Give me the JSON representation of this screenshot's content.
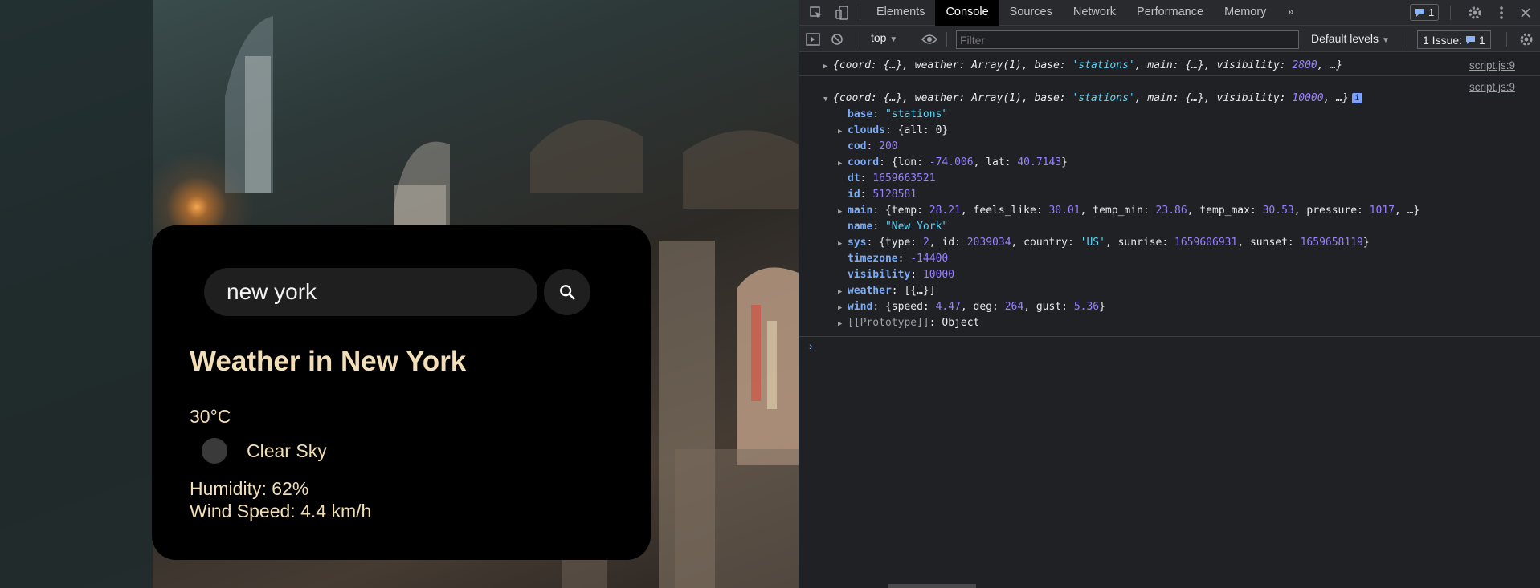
{
  "app": {
    "search": {
      "value": "new york",
      "button_icon": "search-icon"
    },
    "title": "Weather in New York",
    "temperature": "30°C",
    "icon": "weather-icon",
    "description": "Clear Sky",
    "humidity": "Humidity: 62%",
    "wind": "Wind Speed: 4.4 km/h",
    "colors": {
      "card": "#000000",
      "text": "#f3dfb7"
    }
  },
  "devtools": {
    "tabs": [
      {
        "label": "Elements"
      },
      {
        "label": "Console",
        "active": true
      },
      {
        "label": "Sources"
      },
      {
        "label": "Network"
      },
      {
        "label": "Performance"
      },
      {
        "label": "Memory"
      }
    ],
    "more_tabs": "»",
    "message_count": "1",
    "context": "top",
    "filter_placeholder": "Filter",
    "levels": "Default levels",
    "issues_label": "1 Issue:",
    "issues_count": "1",
    "console": {
      "entry1": {
        "summary": {
          "coord": "{…}",
          "weather": "Array(1)",
          "base": "'stations'",
          "main": "{…}",
          "visibility": "2800"
        },
        "source": "script.js:9"
      },
      "entry2": {
        "summary": {
          "coord": "{…}",
          "weather": "Array(1)",
          "base": "'stations'",
          "main": "{…}",
          "visibility": "10000"
        },
        "source": "script.js:9",
        "props": {
          "base": "\"stations\"",
          "clouds": "{all: 0}",
          "cod": "200",
          "coord_lon": "-74.006",
          "coord_lat": "40.7143",
          "dt": "1659663521",
          "id": "5128581",
          "main_temp": "28.21",
          "main_feels_like": "30.01",
          "main_temp_min": "23.86",
          "main_temp_max": "30.53",
          "main_pressure": "1017",
          "name": "\"New York\"",
          "sys_type": "2",
          "sys_id": "2039034",
          "sys_country": "'US'",
          "sys_sunrise": "1659606931",
          "sys_sunset": "1659658119",
          "timezone": "-14400",
          "visibility": "10000",
          "weather": "[{…}]",
          "wind_speed": "4.47",
          "wind_deg": "264",
          "wind_gust": "5.36",
          "prototype": "Object"
        }
      }
    }
  }
}
